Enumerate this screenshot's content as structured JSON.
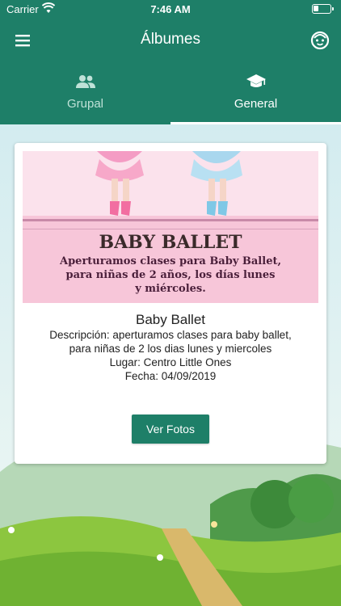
{
  "status_bar": {
    "carrier": "Carrier",
    "time": "7:46 AM"
  },
  "navbar": {
    "title": "Álbumes"
  },
  "tabs": [
    {
      "label": "Grupal",
      "icon": "group-icon"
    },
    {
      "label": "General",
      "icon": "graduation-cap-icon",
      "active": true
    }
  ],
  "album": {
    "banner": {
      "title": "BABY BALLET",
      "subtitle_lines": [
        "Aperturamos clases para  Baby Ballet,",
        "para niñas de 2 años, los días lunes",
        "y miércoles."
      ]
    },
    "title": "Baby Ballet",
    "description": "Descripción: aperturamos clases para baby ballet,",
    "description_cont": "para niñas de 2 los dias lunes y miercoles",
    "place": "Lugar: Centro Little Ones",
    "date": "Fecha: 04/09/2019",
    "button_label": "Ver Fotos"
  },
  "colors": {
    "primary": "#1e7f68",
    "banner_pink": "#f7c6d9",
    "tab_inactive": "#bfe2d8"
  }
}
